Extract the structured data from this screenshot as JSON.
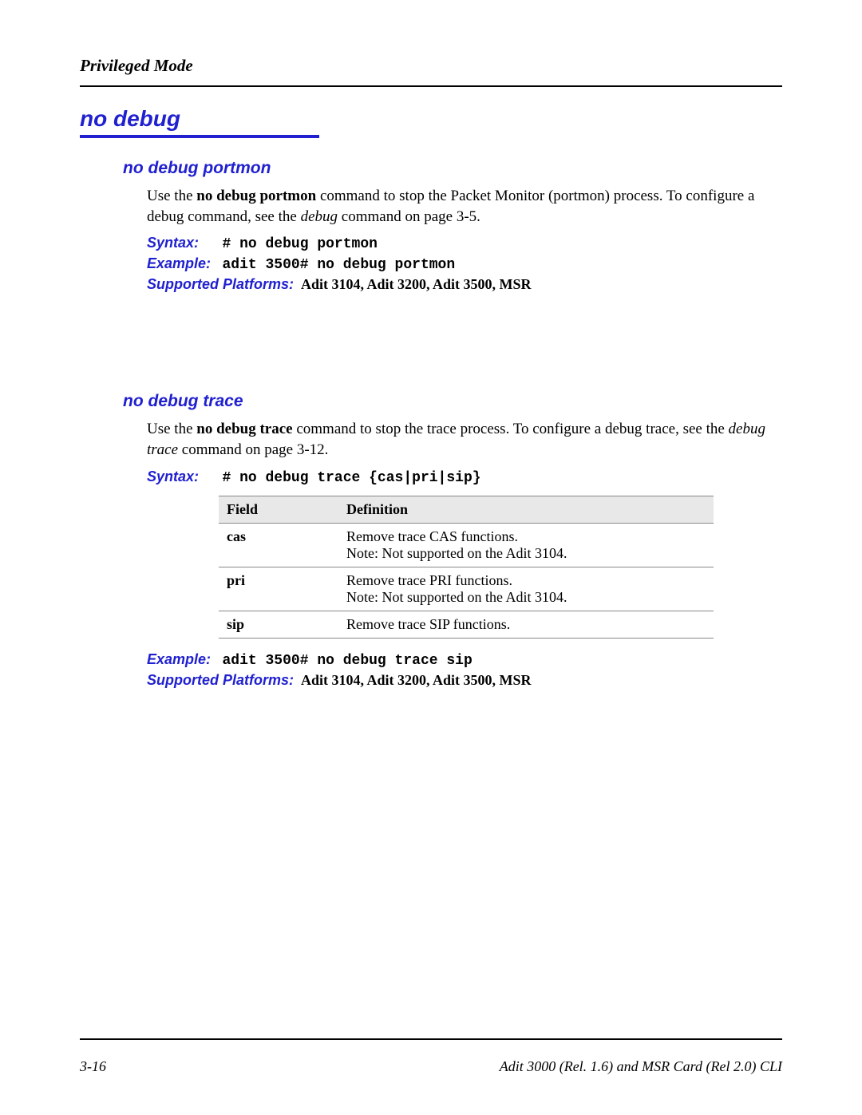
{
  "header": {
    "mode": "Privileged Mode"
  },
  "main_title": "no debug",
  "sections": {
    "portmon": {
      "title": "no debug portmon",
      "desc_pre": "Use the ",
      "desc_bold": "no debug portmon",
      "desc_mid": " command to stop the Packet Monitor (portmon) process. To configure a debug command, see the ",
      "desc_italic": "debug",
      "desc_post": " command on page 3-5.",
      "syntax_label": "Syntax:",
      "syntax_value": "# no debug portmon",
      "example_label": "Example:",
      "example_value": "adit 3500# no debug portmon",
      "platforms_label": "Supported Platforms:",
      "platforms_value": "Adit 3104, Adit 3200, Adit 3500, MSR"
    },
    "trace": {
      "title": "no debug trace",
      "desc_pre": "Use the ",
      "desc_bold": "no debug trace",
      "desc_mid": " command to stop the trace process. To configure a debug trace, see the ",
      "desc_italic": "debug trace",
      "desc_post": " command on page 3-12.",
      "syntax_label": "Syntax:",
      "syntax_value": "# no debug trace {cas|pri|sip}",
      "table": {
        "header_field": "Field",
        "header_def": "Definition",
        "rows": [
          {
            "field": "cas",
            "def_line1": "Remove trace CAS functions.",
            "def_note_label": "Note:",
            "def_note_text": " Not supported on the Adit 3104."
          },
          {
            "field": "pri",
            "def_line1": "Remove trace PRI functions.",
            "def_note_label": "Note:",
            "def_note_text": " Not supported on the Adit 3104."
          },
          {
            "field": "sip",
            "def_line1": "Remove trace SIP functions.",
            "def_note_label": "",
            "def_note_text": ""
          }
        ]
      },
      "example_label": "Example:",
      "example_value": "adit 3500# no debug trace sip",
      "platforms_label": "Supported Platforms:",
      "platforms_value": "Adit 3104, Adit 3200, Adit 3500, MSR"
    }
  },
  "footer": {
    "page_number": "3-16",
    "doc_title": "Adit 3000 (Rel. 1.6) and MSR Card (Rel 2.0) CLI"
  }
}
